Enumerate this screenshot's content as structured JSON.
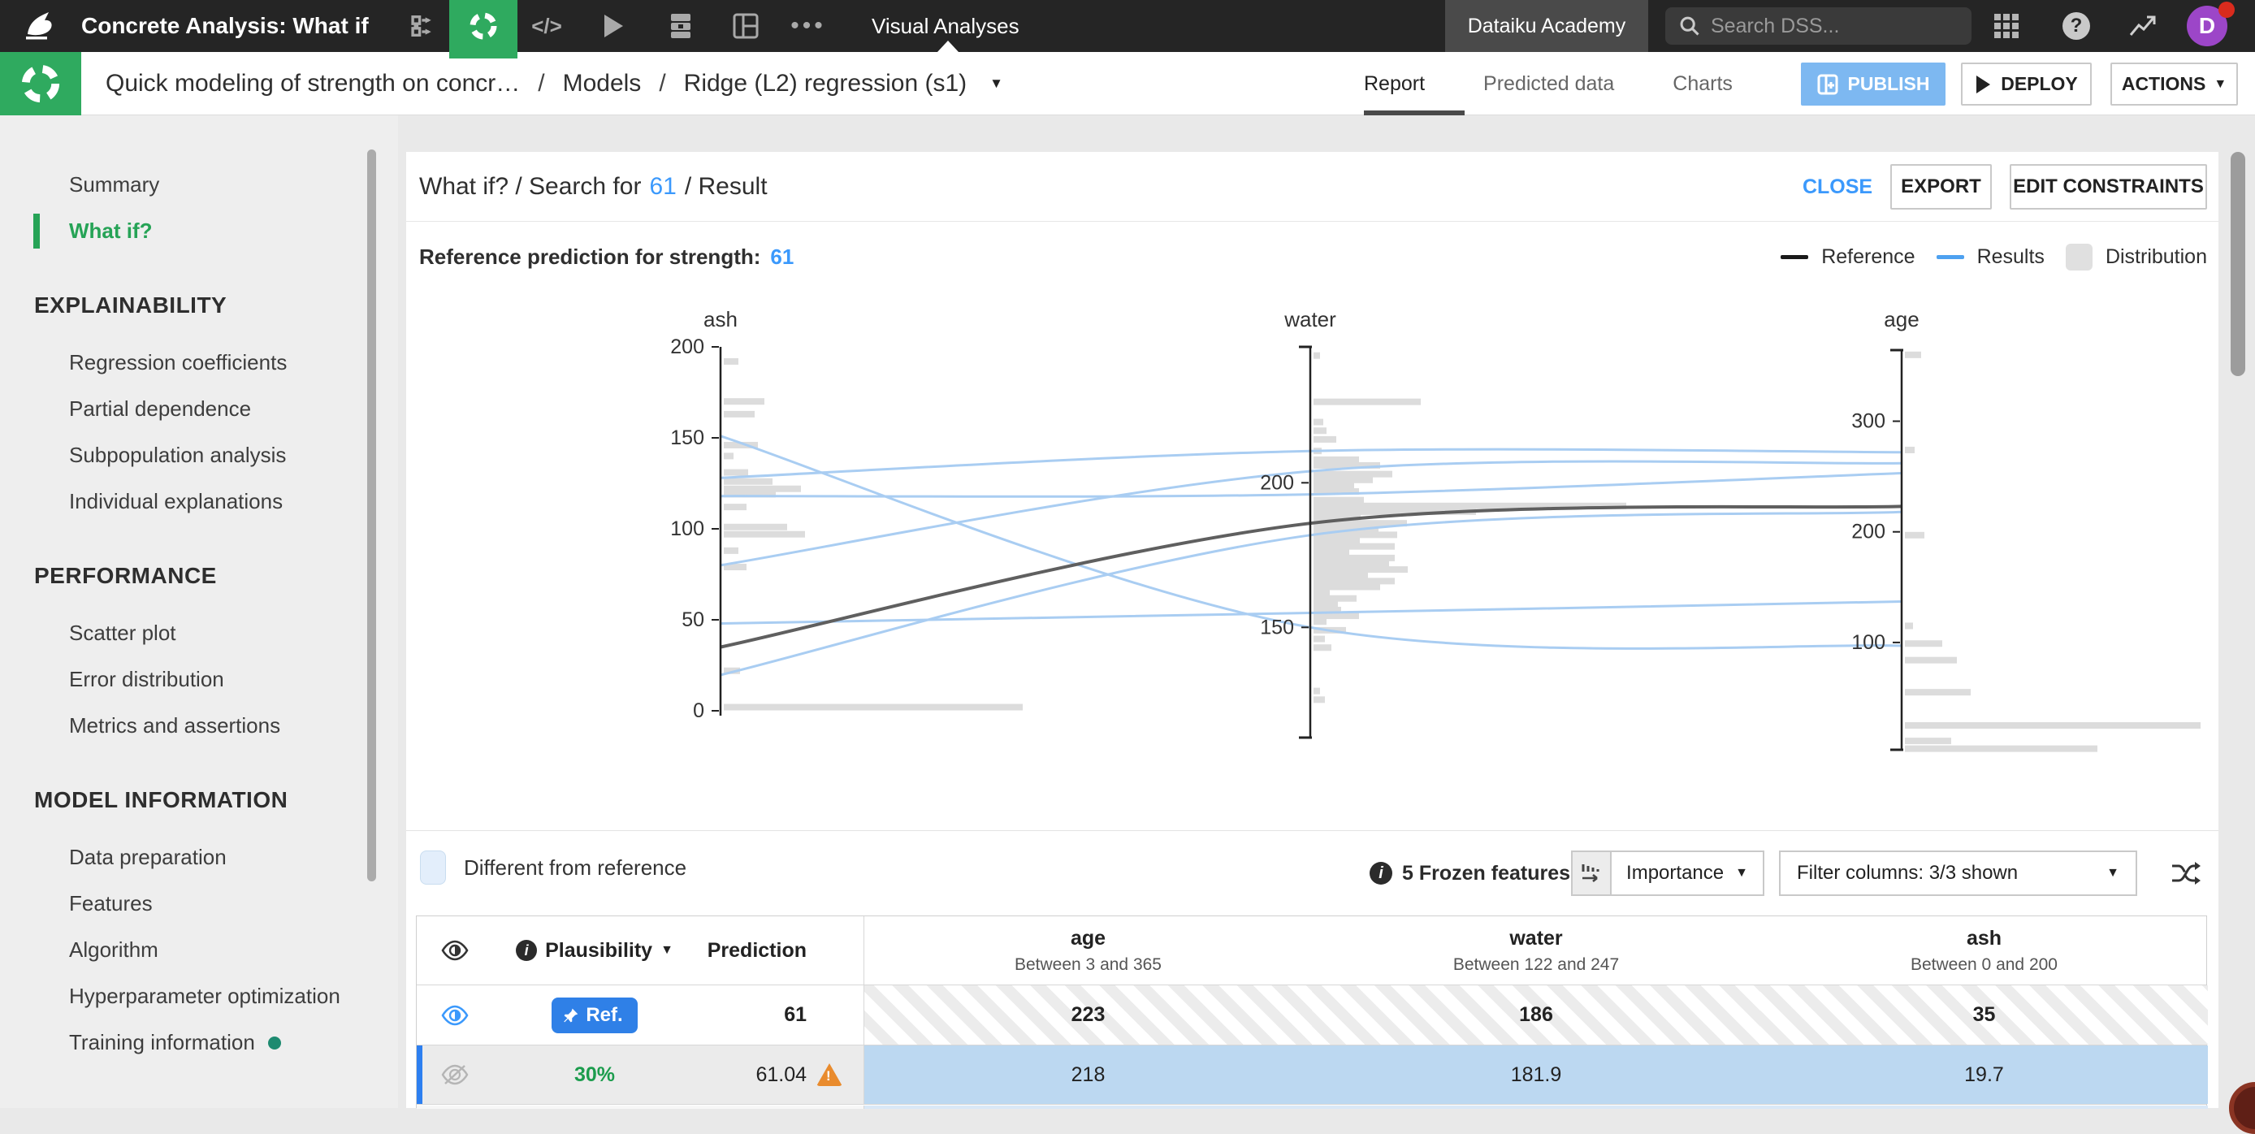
{
  "topbar": {
    "title": "Concrete Analysis: What if",
    "section": "Visual Analyses",
    "academy": "Dataiku Academy",
    "search_placeholder": "Search DSS...",
    "avatar_initial": "D"
  },
  "breadcrumb": {
    "project": "Quick modeling of strength on concr…",
    "separator": "/",
    "models": "Models",
    "model": "Ridge (L2) regression (s1)",
    "tabs": [
      {
        "label": "Report",
        "active": true
      },
      {
        "label": "Predicted data",
        "active": false
      },
      {
        "label": "Charts",
        "active": false
      }
    ],
    "publish_label": "PUBLISH",
    "deploy_label": "DEPLOY",
    "actions_label": "ACTIONS"
  },
  "sidebar": {
    "groups": [
      {
        "header": "",
        "items": [
          {
            "label": "Summary",
            "active": false
          },
          {
            "label": "What if?",
            "active": true
          }
        ]
      },
      {
        "header": "EXPLAINABILITY",
        "items": [
          {
            "label": "Regression coefficients",
            "active": false
          },
          {
            "label": "Partial dependence",
            "active": false
          },
          {
            "label": "Subpopulation analysis",
            "active": false
          },
          {
            "label": "Individual explanations",
            "active": false
          }
        ]
      },
      {
        "header": "PERFORMANCE",
        "items": [
          {
            "label": "Scatter plot",
            "active": false
          },
          {
            "label": "Error distribution",
            "active": false
          },
          {
            "label": "Metrics and assertions",
            "active": false
          }
        ]
      },
      {
        "header": "MODEL INFORMATION",
        "items": [
          {
            "label": "Data preparation",
            "active": false
          },
          {
            "label": "Features",
            "active": false
          },
          {
            "label": "Algorithm",
            "active": false
          },
          {
            "label": "Hyperparameter optimization",
            "active": false
          },
          {
            "label": "Training information",
            "active": false,
            "dot": true
          }
        ]
      }
    ]
  },
  "panel": {
    "title_prefix": "What if? / Search for",
    "title_value": "61",
    "title_suffix": "/ Result",
    "close_label": "CLOSE",
    "export_label": "EXPORT",
    "edit_constraints_label": "EDIT CONSTRAINTS",
    "reference_label": "Reference prediction for strength:",
    "reference_value": "61",
    "legend": [
      {
        "label": "Reference",
        "type": "dash",
        "color": "#1a1a1a"
      },
      {
        "label": "Results",
        "type": "dash",
        "color": "#4ea1f0"
      },
      {
        "label": "Distribution",
        "type": "swatch",
        "color": "#e0e0e0"
      }
    ]
  },
  "chart_data": {
    "type": "parallel-coordinates",
    "axes": [
      {
        "name": "ash",
        "domain": [
          0,
          200
        ],
        "ticks": [
          0,
          50,
          100,
          150,
          200
        ]
      },
      {
        "name": "water",
        "domain": [
          122,
          247
        ],
        "ticks": [
          150,
          200
        ]
      },
      {
        "name": "age",
        "domain": [
          3,
          365
        ],
        "ticks": [
          100,
          200,
          300
        ]
      }
    ],
    "reference": {
      "ash": 35,
      "water": 186,
      "age": 223
    },
    "results": [
      {
        "ash": 151,
        "water": 150,
        "age": 97
      },
      {
        "ash": 128,
        "water": 211,
        "age": 272
      },
      {
        "ash": 118,
        "water": 196,
        "age": 253
      },
      {
        "ash": 80,
        "water": 204,
        "age": 262
      },
      {
        "ash": 48,
        "water": 155,
        "age": 137
      },
      {
        "ash": 19.7,
        "water": 181.9,
        "age": 218
      }
    ],
    "distributions": {
      "ash": [
        [
          192,
          18
        ],
        [
          170,
          50
        ],
        [
          163,
          38
        ],
        [
          146,
          42
        ],
        [
          140,
          12
        ],
        [
          131,
          30
        ],
        [
          126,
          60
        ],
        [
          122,
          95
        ],
        [
          119,
          64
        ],
        [
          112,
          28
        ],
        [
          101,
          78
        ],
        [
          97,
          100
        ],
        [
          88,
          18
        ],
        [
          79,
          28
        ],
        [
          22,
          20
        ],
        [
          2,
          368
        ]
      ],
      "water": [
        [
          244,
          8
        ],
        [
          228,
          132
        ],
        [
          221,
          12
        ],
        [
          218,
          16
        ],
        [
          215,
          28
        ],
        [
          211,
          10
        ],
        [
          208,
          56
        ],
        [
          206,
          82
        ],
        [
          203,
          97
        ],
        [
          201,
          73
        ],
        [
          199,
          50
        ],
        [
          197,
          56
        ],
        [
          194,
          62
        ],
        [
          192,
          385
        ],
        [
          190,
          200
        ],
        [
          188,
          58
        ],
        [
          186,
          115
        ],
        [
          184,
          80
        ],
        [
          182,
          103
        ],
        [
          180,
          57
        ],
        [
          178,
          100
        ],
        [
          176,
          44
        ],
        [
          174,
          100
        ],
        [
          172,
          93
        ],
        [
          170,
          116
        ],
        [
          168,
          67
        ],
        [
          166,
          100
        ],
        [
          164,
          82
        ],
        [
          162,
          20
        ],
        [
          160,
          53
        ],
        [
          158,
          30
        ],
        [
          156,
          34
        ],
        [
          154,
          56
        ],
        [
          152,
          16
        ],
        [
          149,
          40
        ],
        [
          146,
          14
        ],
        [
          143,
          22
        ],
        [
          128,
          8
        ],
        [
          125,
          14
        ]
      ],
      "age": [
        [
          360,
          20
        ],
        [
          274,
          12
        ],
        [
          197,
          24
        ],
        [
          115,
          10
        ],
        [
          99,
          46
        ],
        [
          84,
          64
        ],
        [
          55,
          81
        ],
        [
          25,
          364
        ],
        [
          11,
          57
        ],
        [
          4,
          237
        ]
      ]
    },
    "colors": {
      "reference": "#5f5f5f",
      "results": "#a9cdf2",
      "distribution": "#dcdcdc"
    },
    "legend_position": "top-right",
    "grid": false
  },
  "controls": {
    "different_label": "Different from reference",
    "frozen_label": "5 Frozen features",
    "sort_label": "Importance",
    "filter_label": "Filter columns: 3/3 shown"
  },
  "table": {
    "plausibility_label": "Plausibility",
    "prediction_label": "Prediction",
    "features": [
      {
        "key": "age",
        "name": "age",
        "range": "Between 3 and 365"
      },
      {
        "key": "water",
        "name": "water",
        "range": "Between 122 and 247"
      },
      {
        "key": "ash",
        "name": "ash",
        "range": "Between 0 and 200"
      }
    ],
    "rows": [
      {
        "kind": "reference",
        "badge": "Ref.",
        "prediction": "61",
        "warning": false,
        "selected": false,
        "age": "223",
        "water": "186",
        "ash": "35"
      },
      {
        "kind": "result",
        "plausibility": "30%",
        "prediction": "61.04",
        "warning": true,
        "selected": true,
        "age": "218",
        "water": "181.9",
        "ash": "19.7"
      }
    ]
  }
}
